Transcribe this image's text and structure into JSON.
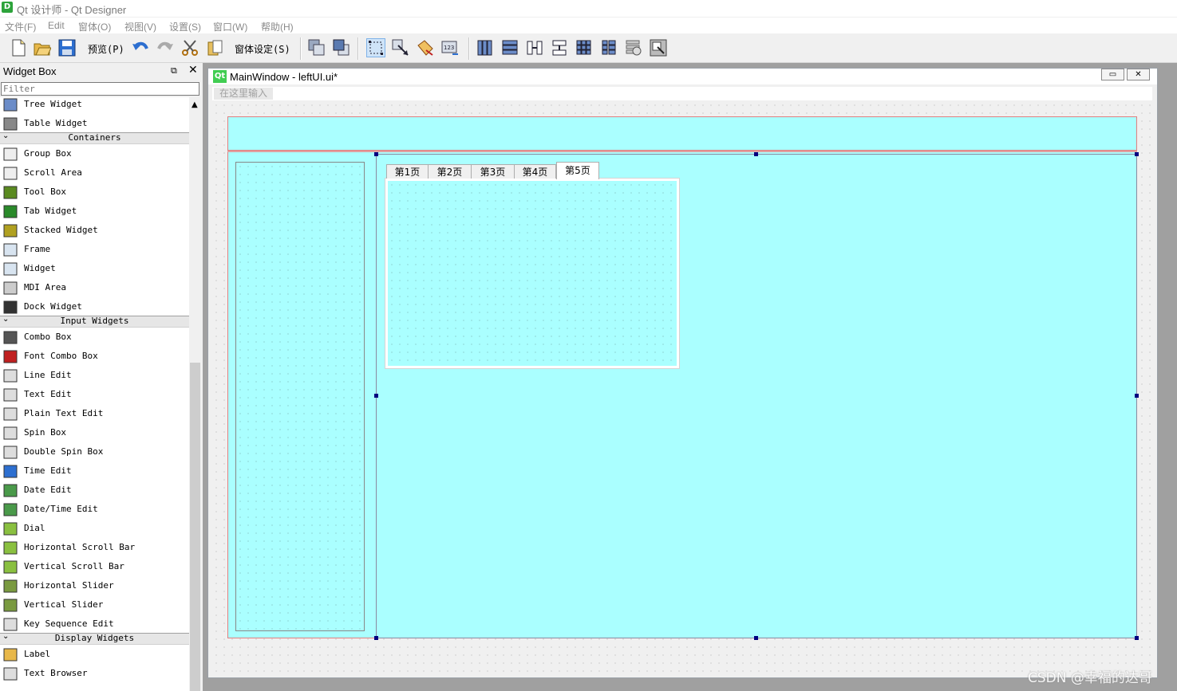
{
  "window": {
    "title": "Qt 设计师 - Qt Designer",
    "logo": "D"
  },
  "menubar": [
    "文件(F)",
    "Edit",
    "窗体(O)",
    "视图(V)",
    "设置(S)",
    "窗口(W)",
    "帮助(H)"
  ],
  "toolbar": {
    "preview_label": "预览(P)",
    "form_settings_label": "窗体设定(S)"
  },
  "widget_box": {
    "title": "Widget Box",
    "float_icon": "⧉",
    "close_icon": "✕",
    "filter_placeholder": "Filter",
    "items_top": [
      {
        "label": "Tree Widget",
        "icon": "tree-widget-icon"
      },
      {
        "label": "Table Widget",
        "icon": "table-widget-icon"
      }
    ],
    "containers_label": "Containers",
    "containers": [
      {
        "label": "Group Box",
        "icon": "group-box-icon"
      },
      {
        "label": "Scroll Area",
        "icon": "scroll-area-icon"
      },
      {
        "label": "Tool Box",
        "icon": "tool-box-icon"
      },
      {
        "label": "Tab Widget",
        "icon": "tab-widget-icon"
      },
      {
        "label": "Stacked Widget",
        "icon": "stacked-widget-icon"
      },
      {
        "label": "Frame",
        "icon": "frame-icon"
      },
      {
        "label": "Widget",
        "icon": "widget-icon"
      },
      {
        "label": "MDI Area",
        "icon": "mdi-area-icon"
      },
      {
        "label": "Dock Widget",
        "icon": "dock-widget-icon"
      }
    ],
    "input_label": "Input Widgets",
    "inputs": [
      {
        "label": "Combo Box",
        "icon": "combo-box-icon"
      },
      {
        "label": "Font Combo Box",
        "icon": "font-combo-box-icon"
      },
      {
        "label": "Line Edit",
        "icon": "line-edit-icon"
      },
      {
        "label": "Text Edit",
        "icon": "text-edit-icon"
      },
      {
        "label": "Plain Text Edit",
        "icon": "plain-text-edit-icon"
      },
      {
        "label": "Spin Box",
        "icon": "spin-box-icon"
      },
      {
        "label": "Double Spin Box",
        "icon": "double-spin-box-icon"
      },
      {
        "label": "Time Edit",
        "icon": "time-edit-icon"
      },
      {
        "label": "Date Edit",
        "icon": "date-edit-icon"
      },
      {
        "label": "Date/Time Edit",
        "icon": "date-time-edit-icon"
      },
      {
        "label": "Dial",
        "icon": "dial-icon"
      },
      {
        "label": "Horizontal Scroll Bar",
        "icon": "horizontal-scroll-bar-icon"
      },
      {
        "label": "Vertical Scroll Bar",
        "icon": "vertical-scroll-bar-icon"
      },
      {
        "label": "Horizontal Slider",
        "icon": "horizontal-slider-icon"
      },
      {
        "label": "Vertical Slider",
        "icon": "vertical-slider-icon"
      },
      {
        "label": "Key Sequence Edit",
        "icon": "key-sequence-edit-icon"
      }
    ],
    "display_label": "Display Widgets",
    "display": [
      {
        "label": "Label",
        "icon": "label-icon"
      },
      {
        "label": "Text Browser",
        "icon": "text-browser-icon"
      }
    ]
  },
  "subwindow": {
    "title": "MainWindow - leftUI.ui*",
    "logo": "Qt",
    "menu_placeholder": "在这里输入",
    "tabs": [
      "第1页",
      "第2页",
      "第3页",
      "第4页",
      "第5页"
    ],
    "active_tab": 4
  },
  "watermark": "CSDN @幸福的达哥",
  "colors": {
    "canvas_cyan": "#aaffff",
    "selection_handle": "#000080",
    "frame_border": "#e08080"
  }
}
